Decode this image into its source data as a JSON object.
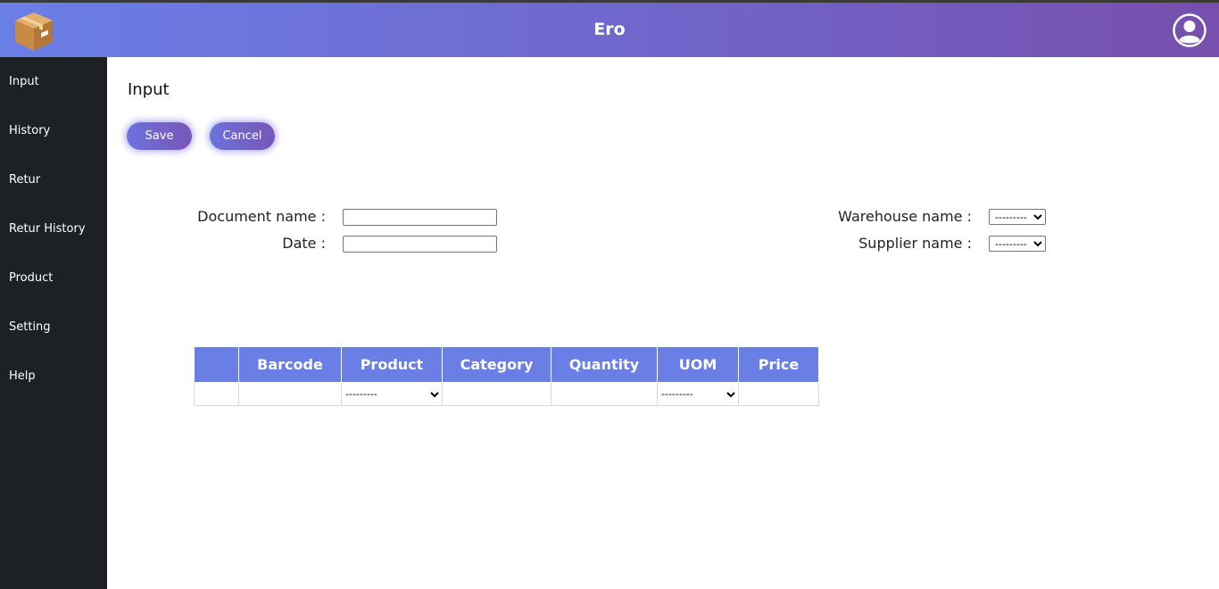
{
  "app": {
    "title": "Ero"
  },
  "header": {
    "logo_icon": "package-box-icon",
    "avatar_icon": "user-avatar-icon"
  },
  "sidebar": {
    "items": [
      {
        "label": "Input"
      },
      {
        "label": "History"
      },
      {
        "label": "Retur"
      },
      {
        "label": "Retur History"
      },
      {
        "label": "Product"
      },
      {
        "label": "Setting"
      },
      {
        "label": "Help"
      }
    ]
  },
  "main": {
    "title": "Input",
    "save_label": "Save",
    "cancel_label": "Cancel",
    "form": {
      "document_name_label": "Document name :",
      "document_name_value": "",
      "date_label": "Date :",
      "date_value": "",
      "warehouse_label": "Warehouse name :",
      "warehouse_selected": "---------",
      "supplier_label": "Supplier name :",
      "supplier_selected": "---------"
    },
    "table": {
      "headers": [
        "",
        "Barcode",
        "Product",
        "Category",
        "Quantity",
        "UOM",
        "Price"
      ],
      "product_selected": "---------",
      "uom_selected": "---------"
    }
  },
  "colors": {
    "header_start": "#6a7fe6",
    "header_end": "#774fae",
    "sidebar": "#1e2124",
    "table_header": "#6a7fe6"
  }
}
